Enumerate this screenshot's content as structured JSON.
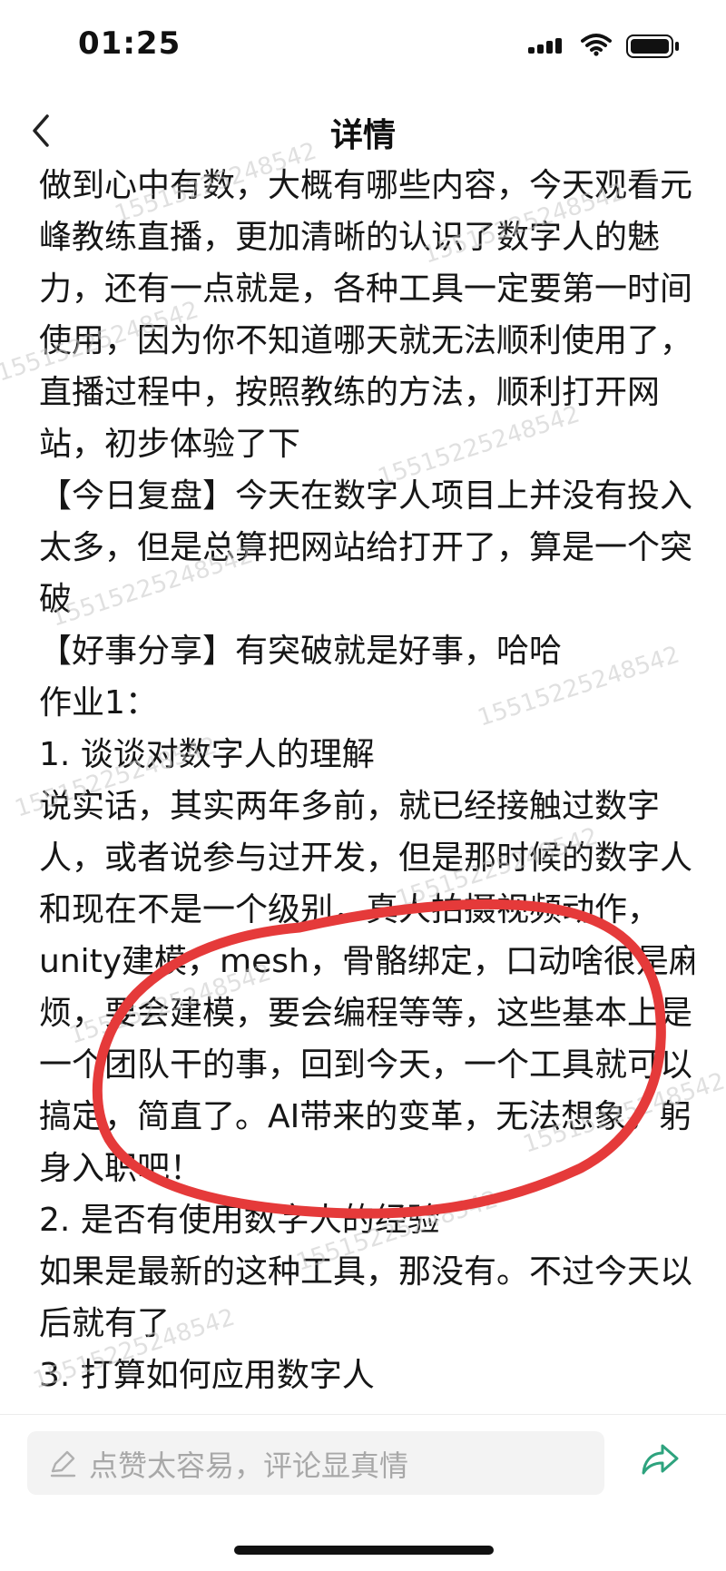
{
  "status_bar": {
    "time": "01:25",
    "signal_icon": "cellular-signal-icon",
    "wifi_icon": "wifi-icon",
    "battery_icon": "battery-icon"
  },
  "nav": {
    "back_icon": "chevron-left-icon",
    "title": "详情"
  },
  "content": {
    "lines": [
      "做到心中有数，大概有哪些内容，今天观看元",
      "峰教练直播，更加清晰的认识了数字人的魅",
      "力，还有一点就是，各种工具一定要第一时间",
      "使用，因为你不知道哪天就无法顺利使用了，",
      "直播过程中，按照教练的方法，顺利打开网",
      "站，初步体验了下",
      "【今日复盘】今天在数字人项目上并没有投入",
      "太多，但是总算把网站给打开了，算是一个突",
      "破",
      "【好事分享】有突破就是好事，哈哈",
      "作业1：",
      "1. 谈谈对数字人的理解",
      "说实话，其实两年多前，就已经接触过数字",
      "人，或者说参与过开发，但是那时候的数字人",
      "和现在不是一个级别，真人拍摄视频动作，",
      "unity建模，mesh，骨骼绑定，口动啥很是麻",
      "烦，要会建模，要会编程等等，这些基本上是",
      "一个团队干的事，回到今天，一个工具就可以",
      "搞定，简直了。AI带来的变革，无法想象。躬",
      "身入职吧！",
      "2. 是否有使用数字人的经验",
      "如果是最新的这种工具，那没有。不过今天以",
      "后就有了",
      "3. 打算如何应用数字人"
    ]
  },
  "watermark": {
    "text": "15515225248542"
  },
  "annotation": {
    "color": "#e53a3a"
  },
  "bottom_bar": {
    "comment_placeholder": "点赞太容易，评论显真情",
    "pen_icon": "pen-icon",
    "share_icon": "share-icon",
    "accent_color": "#2ea37e"
  }
}
